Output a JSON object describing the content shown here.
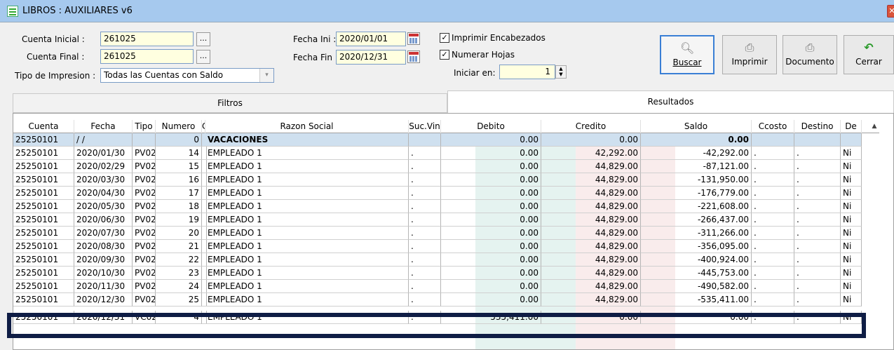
{
  "window": {
    "title": "LIBROS : AUXILIARES v6",
    "close_glyph": "✕"
  },
  "filters": {
    "cuenta_inicial_label": "Cuenta Inicial :",
    "cuenta_inicial_value": "261025",
    "cuenta_final_label": "Cuenta Final :",
    "cuenta_final_value": "261025",
    "browse_label": "...",
    "tipo_impresion_label": "Tipo de Impresion :",
    "tipo_impresion_value": "Todas las Cuentas con Saldo",
    "fecha_ini_label": "Fecha Ini :",
    "fecha_ini_value": "2020/01/01",
    "fecha_fin_label": "Fecha Fin :",
    "fecha_fin_value": "2020/12/31",
    "imprimir_encabezados_label": "Imprimir Encabezados",
    "imprimir_encabezados_checked": true,
    "numerar_hojas_label": "Numerar Hojas",
    "numerar_hojas_checked": true,
    "iniciar_en_label": "Iniciar en:",
    "iniciar_en_value": "1",
    "check_glyph": "✓"
  },
  "toolbar": {
    "buscar": "Buscar",
    "imprimir": "Imprimir",
    "documento": "Documento",
    "cerrar": "Cerrar"
  },
  "tabs": {
    "filtros": "Filtros",
    "resultados": "Resultados"
  },
  "grid": {
    "columns": [
      "Cuenta",
      "Fecha",
      "Tipo",
      "Numero",
      "C",
      "Razon Social",
      "Suc.Vin",
      "Debito",
      "Credito",
      "Saldo",
      "Ccosto",
      "Destino",
      "De"
    ],
    "rows": [
      [
        "25250101",
        "/ /",
        "",
        "0",
        "",
        "VACACIONES",
        "",
        "0.00",
        "0.00",
        "0.00",
        "",
        "",
        ""
      ],
      [
        "25250101",
        "2020/01/30",
        "PV02",
        "14",
        "",
        "EMPLEADO 1",
        ".",
        "0.00",
        "42,292.00",
        "-42,292.00",
        ".",
        ".",
        "Ni"
      ],
      [
        "25250101",
        "2020/02/29",
        "PV02",
        "15",
        "",
        "EMPLEADO 1",
        ".",
        "0.00",
        "44,829.00",
        "-87,121.00",
        ".",
        ".",
        "Ni"
      ],
      [
        "25250101",
        "2020/03/30",
        "PV02",
        "16",
        "",
        "EMPLEADO 1",
        ".",
        "0.00",
        "44,829.00",
        "-131,950.00",
        ".",
        ".",
        "Ni"
      ],
      [
        "25250101",
        "2020/04/30",
        "PV02",
        "17",
        "",
        "EMPLEADO 1",
        ".",
        "0.00",
        "44,829.00",
        "-176,779.00",
        ".",
        ".",
        "Ni"
      ],
      [
        "25250101",
        "2020/05/30",
        "PV02",
        "18",
        "",
        "EMPLEADO 1",
        ".",
        "0.00",
        "44,829.00",
        "-221,608.00",
        ".",
        ".",
        "Ni"
      ],
      [
        "25250101",
        "2020/06/30",
        "PV02",
        "19",
        "",
        "EMPLEADO 1",
        ".",
        "0.00",
        "44,829.00",
        "-266,437.00",
        ".",
        ".",
        "Ni"
      ],
      [
        "25250101",
        "2020/07/30",
        "PV02",
        "20",
        "",
        "EMPLEADO 1",
        ".",
        "0.00",
        "44,829.00",
        "-311,266.00",
        ".",
        ".",
        "Ni"
      ],
      [
        "25250101",
        "2020/08/30",
        "PV02",
        "21",
        "",
        "EMPLEADO 1",
        ".",
        "0.00",
        "44,829.00",
        "-356,095.00",
        ".",
        ".",
        "Ni"
      ],
      [
        "25250101",
        "2020/09/30",
        "PV02",
        "22",
        "",
        "EMPLEADO 1",
        ".",
        "0.00",
        "44,829.00",
        "-400,924.00",
        ".",
        ".",
        "Ni"
      ],
      [
        "25250101",
        "2020/10/30",
        "PV02",
        "23",
        "",
        "EMPLEADO 1",
        ".",
        "0.00",
        "44,829.00",
        "-445,753.00",
        ".",
        ".",
        "Ni"
      ],
      [
        "25250101",
        "2020/11/30",
        "PV02",
        "24",
        "",
        "EMPLEADO 1",
        ".",
        "0.00",
        "44,829.00",
        "-490,582.00",
        ".",
        ".",
        "Ni"
      ],
      [
        "25250101",
        "2020/12/30",
        "PV02",
        "25",
        "",
        "EMPLEADO 1",
        ".",
        "0.00",
        "44,829.00",
        "-535,411.00",
        ".",
        ".",
        "Ni"
      ],
      [
        "25250101",
        "2020/12/31",
        "VC02",
        "4",
        "",
        "EMPLEADO 1",
        ".",
        "535,411.00",
        "0.00",
        "0.00",
        ".",
        ".",
        "Ni"
      ]
    ]
  },
  "colors": {
    "debito_bg": "#e5f3f0",
    "credito_bg": "#f9ecec",
    "highlight": "#0f1d45",
    "selected_row": "#cfe0ef"
  },
  "icons": [
    "app-icon",
    "ellipsis-icon",
    "calendar-icon",
    "checkbox-icon",
    "spinner-icon",
    "dropdown-arrow-icon",
    "magnifier-icon",
    "printer-icon",
    "document-icon",
    "undo-arrow-icon",
    "scroll-up-icon"
  ]
}
